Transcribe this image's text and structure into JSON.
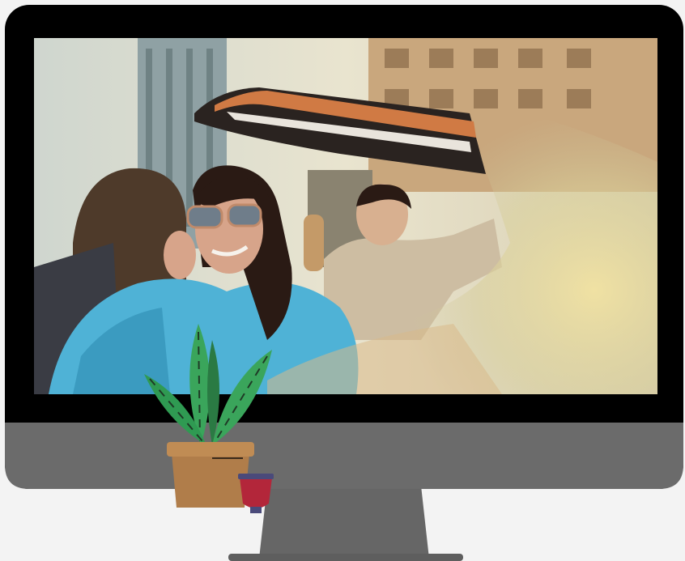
{
  "colors": {
    "page_background": "#f3f3f3",
    "monitor_bezel": "#000000",
    "monitor_chin": "#6b6b6b",
    "monitor_stand": "#666666",
    "plant_leaf": "#3aa55b",
    "plant_leaf_dark": "#2a7a43",
    "plant_pot": "#b07d4a",
    "plant_pot_rim": "#c08c54",
    "cup": "#b3263a",
    "cup_rim": "#4a4a7a"
  },
  "screen": {
    "content": "photo",
    "sky_color": "#d9d6c4",
    "building_color": "#8fa1a4",
    "building_warm_color": "#c9a77d",
    "car_seat_color": "#4e3a2a",
    "car_top_color": "#2a2320",
    "car_top_stripe_color": "#d07a44",
    "person_left_coat": "#4fb2d6",
    "person_left_skin": "#d7a48a",
    "person_left_hair": "#2a1a14",
    "person_right_coat": "#cdbda2",
    "person_right_skin": "#d8b090",
    "glare_color": "#eadb9a"
  },
  "icons": {
    "monitor": "monitor-icon",
    "plant": "plant-icon",
    "cup": "cup-icon"
  }
}
